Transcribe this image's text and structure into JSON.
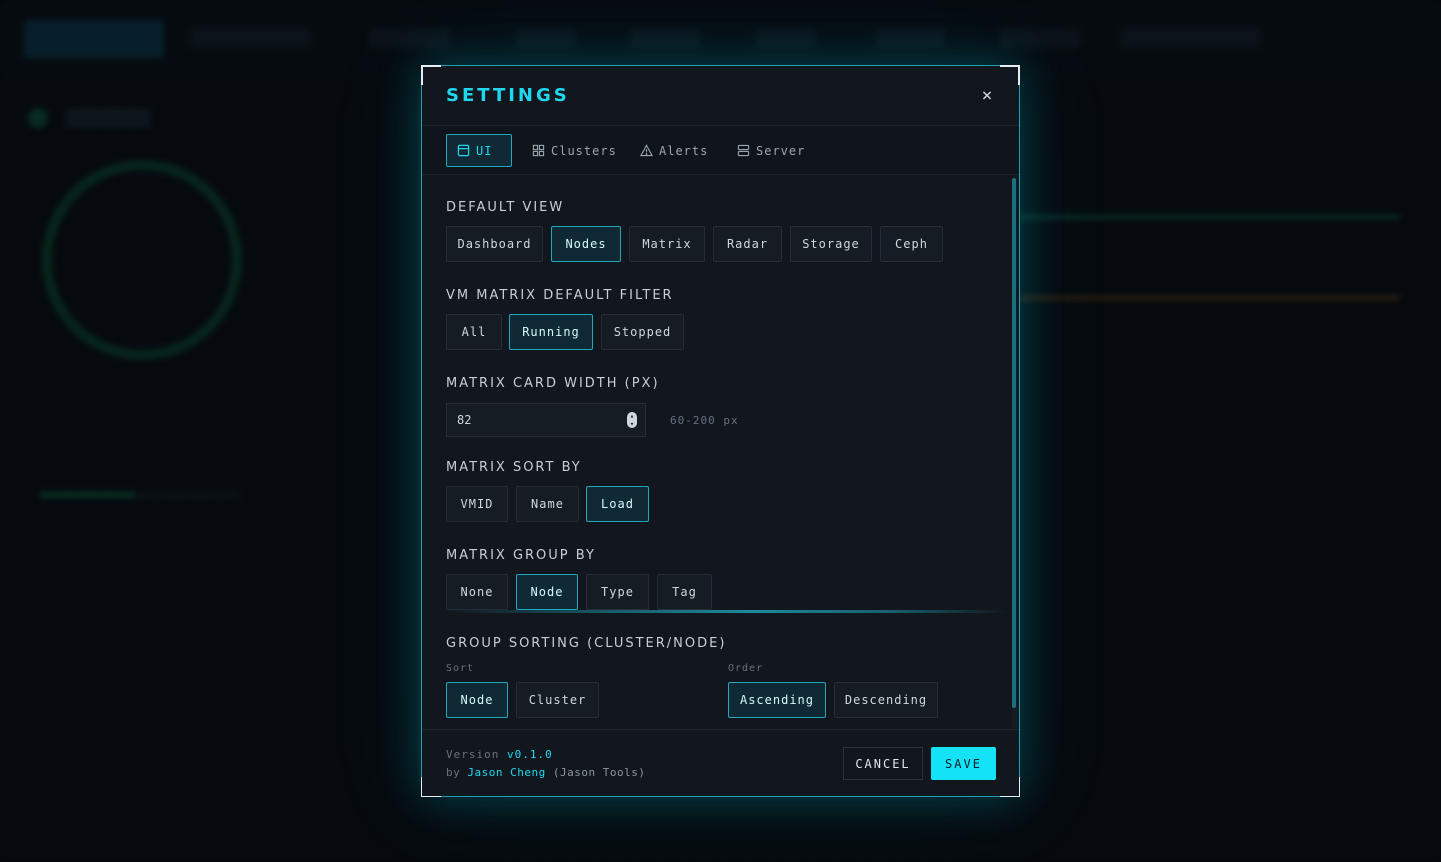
{
  "modal": {
    "title": "SETTINGS",
    "close_icon": "×"
  },
  "tabs": [
    {
      "label": "UI",
      "icon": "window-icon",
      "active": true
    },
    {
      "label": "Clusters",
      "icon": "grid-icon",
      "active": false
    },
    {
      "label": "Alerts",
      "icon": "warning-icon",
      "active": false
    },
    {
      "label": "Server",
      "icon": "server-icon",
      "active": false
    }
  ],
  "sections": {
    "default_view": {
      "label": "DEFAULT VIEW",
      "options": [
        "Dashboard",
        "Nodes",
        "Matrix",
        "Radar",
        "Storage",
        "Ceph"
      ],
      "selected": "Nodes"
    },
    "vm_filter": {
      "label": "VM MATRIX DEFAULT FILTER",
      "options": [
        "All",
        "Running",
        "Stopped"
      ],
      "selected": "Running"
    },
    "card_width": {
      "label": "MATRIX CARD WIDTH (PX)",
      "value": "82",
      "hint": "60-200 px"
    },
    "sort_by": {
      "label": "MATRIX SORT BY",
      "options": [
        "VMID",
        "Name",
        "Load"
      ],
      "selected": "Load"
    },
    "group_by": {
      "label": "MATRIX GROUP BY",
      "options": [
        "None",
        "Node",
        "Type",
        "Tag"
      ],
      "selected": "Node"
    },
    "group_sorting": {
      "label": "GROUP SORTING (CLUSTER/NODE)",
      "sort_label": "Sort",
      "sort_options": [
        "Node",
        "Cluster"
      ],
      "sort_selected": "Node",
      "order_label": "Order",
      "order_options": [
        "Ascending",
        "Descending"
      ],
      "order_selected": "Ascending"
    }
  },
  "footer": {
    "version_prefix": "Version",
    "version": "v0.1.0",
    "by": "by",
    "author": "Jason Cheng",
    "org": "(Jason Tools)",
    "cancel": "CANCEL",
    "save": "SAVE"
  },
  "colors": {
    "accent": "#1fd8f0",
    "border_accent": "#1fa7bd",
    "panel": "#12171e",
    "save_bg": "#14e3f7"
  }
}
